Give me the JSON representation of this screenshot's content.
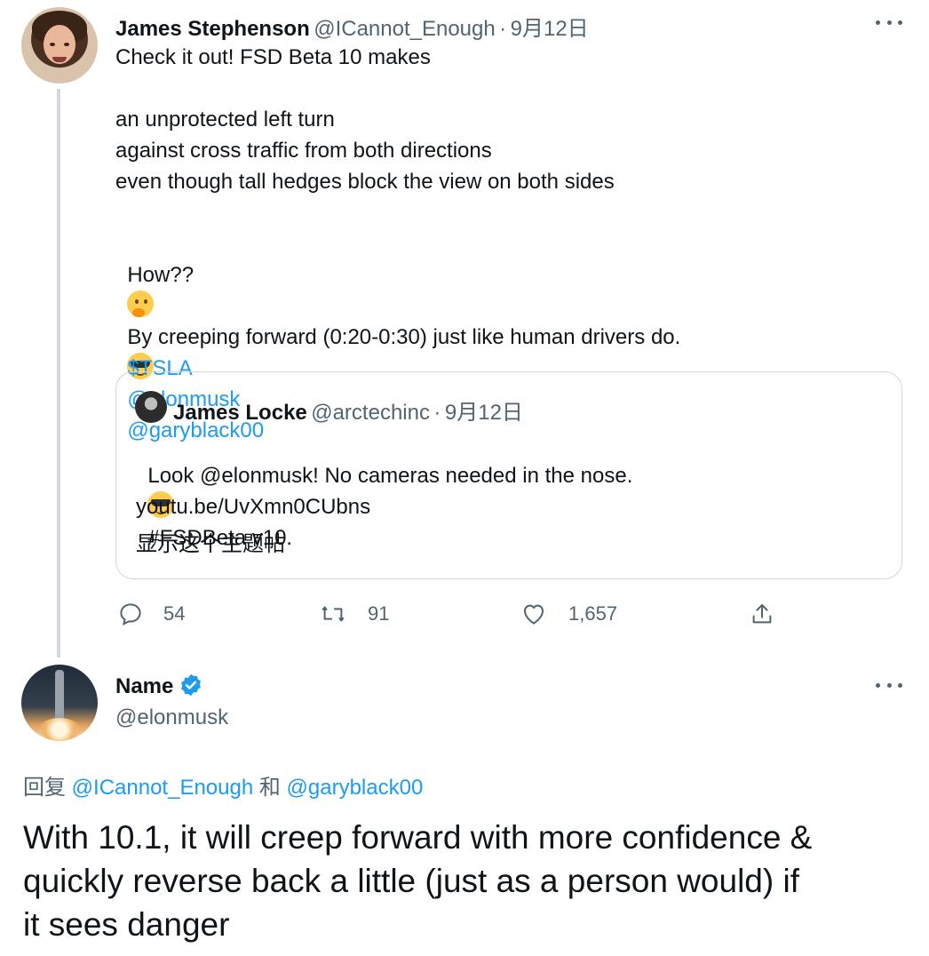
{
  "tweet": {
    "author_name": "James Stephenson",
    "author_handle": "@ICannot_Enough",
    "separator": "·",
    "date": "9月12日",
    "line1": "Check it out! FSD Beta 10 makes",
    "line2": "an unprotected left turn",
    "line3": "against cross traffic from both directions",
    "line4": "even though tall hedges block the view on both sides",
    "line5": "How??",
    "line6": "By creeping forward (0:20-0:30) just like human drivers do.",
    "tag_tsla": "$TSLA",
    "tag_elon": "@elonmusk",
    "tag_gary": "@garyblack00"
  },
  "quote": {
    "author_name": "James Locke",
    "author_handle": "@arctechinc",
    "separator": "·",
    "date": "9月12日",
    "text_before": "Look @elonmusk! No cameras needed in the nose.",
    "text_after": "#FSDBeta v10.",
    "link": "youtu.be/UvXmn0CUbns",
    "show_thread": "显示这个主题帖"
  },
  "actions": {
    "replies": "54",
    "retweets": "91",
    "likes": "1,657"
  },
  "reply": {
    "author_name": "Name",
    "author_handle": "@elonmusk",
    "reply_prefix": "回复",
    "reply_user1": "@ICannot_Enough",
    "reply_and": "和",
    "reply_user2": "@garyblack00",
    "text_line1": "With 10.1, it will creep forward with more confidence &",
    "text_line2": "quickly reverse back a little (just as a person would) if",
    "text_line3": "it sees danger"
  },
  "colors": {
    "link": "#1d9bf0",
    "muted": "#536471",
    "border": "#cfd9de",
    "verified": "#1d9bf0"
  },
  "icons": [
    "more-icon",
    "reply-icon",
    "retweet-icon",
    "like-icon",
    "share-icon",
    "verified-badge-icon",
    "cool-emoji",
    "thinking-emoji"
  ]
}
